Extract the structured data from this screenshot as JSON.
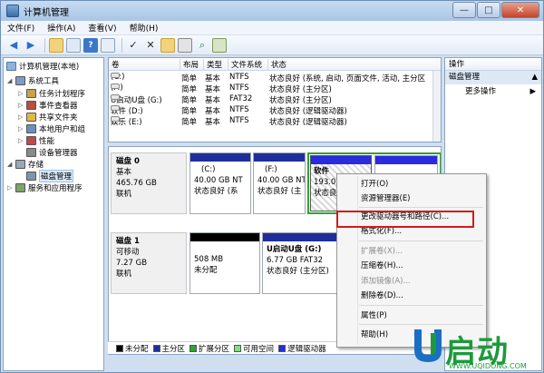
{
  "window": {
    "title": "计算机管理",
    "btn_min": "—",
    "btn_max": "□",
    "btn_close": "✕"
  },
  "menu": [
    "文件(F)",
    "操作(A)",
    "查看(V)",
    "帮助(H)"
  ],
  "tree": {
    "root": "计算机管理(本地)",
    "items": [
      {
        "label": "系统工具",
        "level": 1,
        "twisty": "◢"
      },
      {
        "label": "任务计划程序",
        "level": 2,
        "twisty": "▷"
      },
      {
        "label": "事件查看器",
        "level": 2,
        "twisty": "▷"
      },
      {
        "label": "共享文件夹",
        "level": 2,
        "twisty": "▷"
      },
      {
        "label": "本地用户和组",
        "level": 2,
        "twisty": "▷"
      },
      {
        "label": "性能",
        "level": 2,
        "twisty": "▷"
      },
      {
        "label": "设备管理器",
        "level": 2,
        "twisty": ""
      },
      {
        "label": "存储",
        "level": 1,
        "twisty": "◢"
      },
      {
        "label": "磁盘管理",
        "level": 2,
        "twisty": ""
      },
      {
        "label": "服务和应用程序",
        "level": 1,
        "twisty": "▷"
      }
    ]
  },
  "volumes": {
    "headers": [
      "卷",
      "布局",
      "类型",
      "文件系统",
      "状态"
    ],
    "rows": [
      [
        "(C:)",
        "简单",
        "基本",
        "NTFS",
        "状态良好 (系统, 启动, 页面文件, 活动, 主分区"
      ],
      [
        "(F:)",
        "简单",
        "基本",
        "NTFS",
        "状态良好 (主分区)"
      ],
      [
        "U启动U盘 (G:)",
        "简单",
        "基本",
        "FAT32",
        "状态良好 (主分区)"
      ],
      [
        "软件 (D:)",
        "简单",
        "基本",
        "NTFS",
        "状态良好 (逻辑驱动器)"
      ],
      [
        "娱乐 (E:)",
        "简单",
        "基本",
        "NTFS",
        "状态良好 (逻辑驱动器)"
      ]
    ]
  },
  "disks": [
    {
      "name": "磁盘 0",
      "type": "基本",
      "size": "465.76 GB",
      "status": "联机",
      "parts": [
        {
          "label": "(C:)",
          "size": "40.00 GB NT",
          "status": "状态良好 (系"
        },
        {
          "label": "(F:)",
          "size": "40.00 GB NT",
          "status": "状态良好 (主"
        },
        {
          "label": "软件",
          "size": "193.0",
          "status": "状态良"
        },
        {
          "label": "",
          "size": "",
          "status": ""
        }
      ]
    },
    {
      "name": "磁盘 1",
      "type": "可移动",
      "size": "7.27 GB",
      "status": "联机",
      "parts": [
        {
          "label": "",
          "size": "508 MB",
          "status": "未分配"
        },
        {
          "label": "U启动U盘 (G:)",
          "size": "6.77 GB FAT32",
          "status": "状态良好 (主分区)"
        }
      ]
    }
  ],
  "legend": [
    {
      "label": "未分配",
      "color": "#000000"
    },
    {
      "label": "主分区",
      "color": "#1f2f9a"
    },
    {
      "label": "扩展分区",
      "color": "#2fa32f"
    },
    {
      "label": "可用空间",
      "color": "#7fe07f"
    },
    {
      "label": "逻辑驱动器",
      "color": "#2a2adf"
    }
  ],
  "actions": {
    "header": "操作",
    "section": "磁盘管理",
    "more": "更多操作",
    "arrow": "▲",
    "more_arrow": "▶"
  },
  "context_menu": [
    {
      "label": "打开(O)",
      "disabled": false
    },
    {
      "label": "资源管理器(E)",
      "disabled": false
    },
    {
      "label": "更改驱动器号和路径(C)...",
      "disabled": false
    },
    {
      "label": "格式化(F)...",
      "disabled": false
    },
    {
      "label": "扩展卷(X)...",
      "disabled": true
    },
    {
      "label": "压缩卷(H)...",
      "disabled": false
    },
    {
      "label": "添加镜像(A)...",
      "disabled": true
    },
    {
      "label": "删除卷(D)...",
      "disabled": false
    },
    {
      "label": "属性(P)",
      "disabled": false
    },
    {
      "label": "帮助(H)",
      "disabled": false
    }
  ],
  "logo": {
    "text": "启动",
    "url": "WWW.UQIDONG.COM"
  },
  "colors": {
    "primary": "#1f2f9a",
    "logical": "#2a2adf",
    "extended": "#2fa32f",
    "brand": "#1d9a3c",
    "highlight": "#d21a1a"
  }
}
